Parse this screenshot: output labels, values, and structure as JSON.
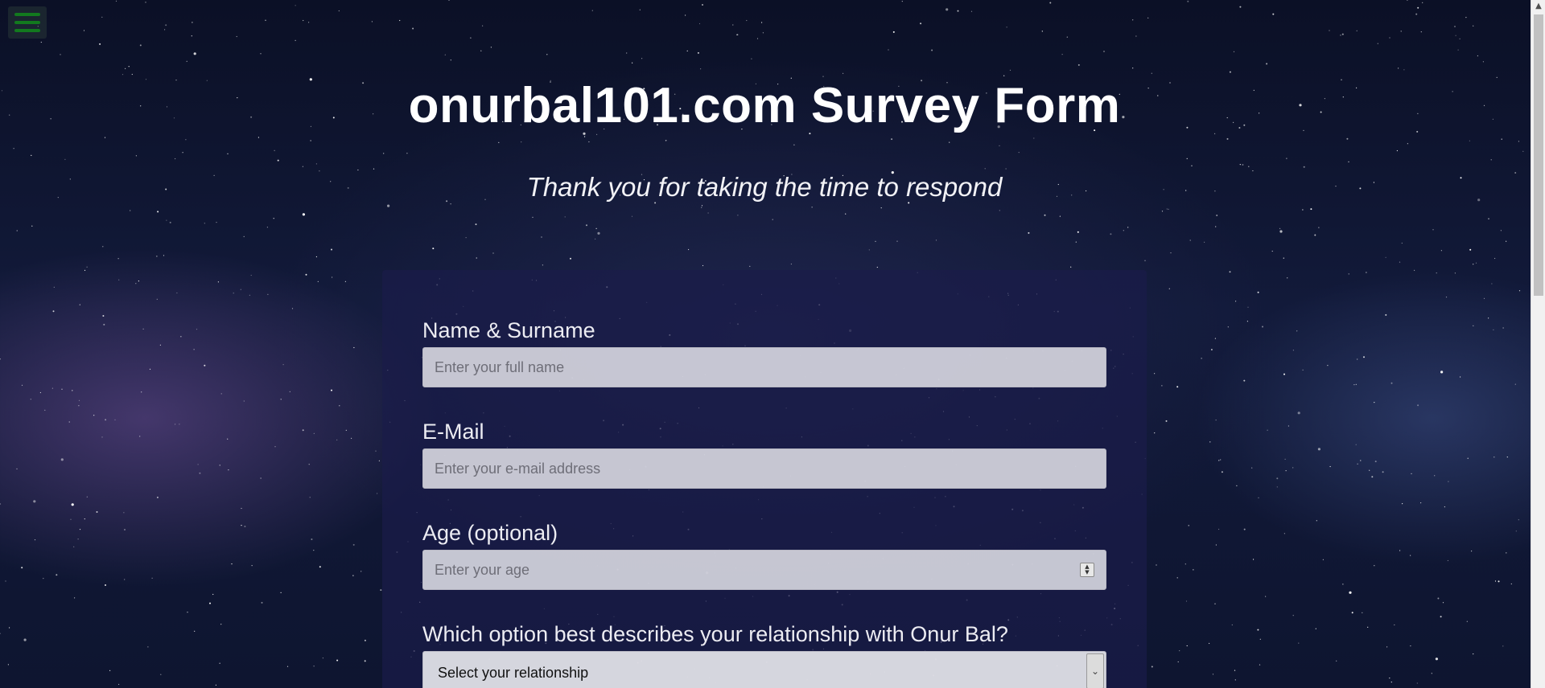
{
  "page": {
    "title": "onurbal101.com Survey Form",
    "subtitle": "Thank you for taking the time to respond"
  },
  "nav": {
    "menu_icon": "hamburger-menu-icon",
    "menu_color": "#127a1e"
  },
  "form": {
    "fields": [
      {
        "label": "Name & Surname",
        "type": "text",
        "placeholder": "Enter your full name",
        "value": ""
      },
      {
        "label": "E-Mail",
        "type": "email",
        "placeholder": "Enter your e-mail address",
        "value": ""
      },
      {
        "label": "Age (optional)",
        "type": "number",
        "placeholder": "Enter your age",
        "value": ""
      }
    ],
    "relationship": {
      "label": "Which option best describes your relationship with Onur Bal?",
      "selected": "Select your relationship"
    }
  },
  "colors": {
    "card_background": "#1b1c4a",
    "input_background": "#dedee6",
    "text": "#ffffff"
  }
}
